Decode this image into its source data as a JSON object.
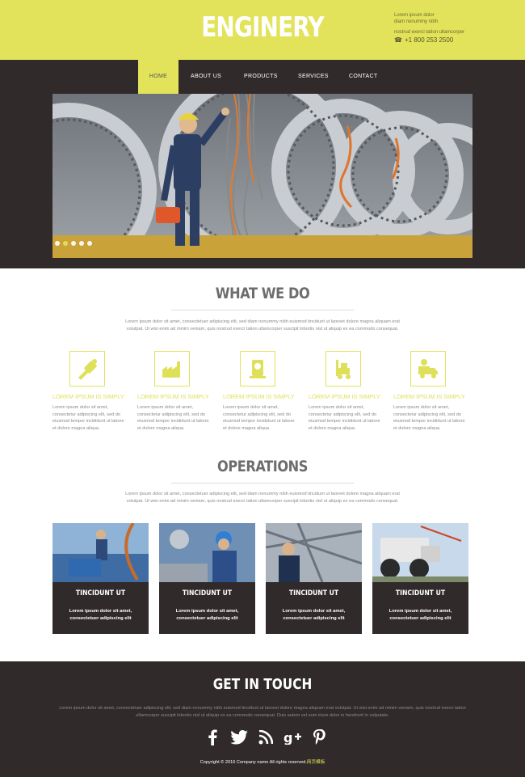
{
  "header": {
    "logo": "ENGINERY",
    "contact_line1": "Lorem ipsum dolor",
    "contact_line2": "diam nonummy nibh",
    "contact_line3": "nostrud exerci tation ullamcorper",
    "phone": "+1 800 253 2500"
  },
  "nav": {
    "items": [
      {
        "label": "HOME",
        "active": true
      },
      {
        "label": "ABOUT US",
        "active": false
      },
      {
        "label": "PRODUCTS",
        "active": false
      },
      {
        "label": "SERVICES",
        "active": false
      },
      {
        "label": "CONTACT",
        "active": false
      }
    ]
  },
  "slider": {
    "dots": 5,
    "active_dot": 2
  },
  "what_we_do": {
    "title": "WHAT WE DO",
    "intro": "Lorem ipsum dolor sit amet, consectetuer adipiscing elit, sed diam nonummy nibh euismod tincidunt ut laoreet dolore magna aliquam erat volutpat. Ut wisi enim ad minim veniam, quis nostrud exerci tation ullamcorper suscipit lobortis nisl ut aliquip ex ea commodo consequat.",
    "features": [
      {
        "icon": "tools-icon",
        "title": "LOREM IPSUM IS SIMPLY",
        "text": "Lorem ipsum dolor sit amet, consectetur adipiscing elit, sed do eiusmod tempor incididunt ut labore et dolore magna aliqua."
      },
      {
        "icon": "factory-icon",
        "title": "LOREM IPSUM IS SIMPLY",
        "text": "Lorem ipsum dolor sit amet, consectetur adipiscing elit, sed do eiusmod tempor incididunt ut labore et dolore magna aliqua."
      },
      {
        "icon": "machine-icon",
        "title": "LOREM IPSUM IS SIMPLY",
        "text": "Lorem ipsum dolor sit amet, consectetur adipiscing elit, sed do eiusmod tempor incididunt ut labore et dolore magna aliqua."
      },
      {
        "icon": "forklift-icon",
        "title": "LOREM IPSUM IS SIMPLY",
        "text": "Lorem ipsum dolor sit amet, consectetur adipiscing elit, sed do eiusmod tempor incididunt ut labore et dolore magna aliqua."
      },
      {
        "icon": "truck-icon",
        "title": "LOREM IPSUM IS SIMPLY",
        "text": "Lorem ipsum dolor sit amet, consectetur adipiscing elit, sed do eiusmod tempor incididunt ut labore et dolore magna aliqua."
      }
    ]
  },
  "operations": {
    "title": "OPERATIONS",
    "intro": "Lorem ipsum dolor sit amet, consectetuer adipiscing elit, sed diam nonummy nibh euismod tincidunt ut laoreet dolore magna aliquam erat volutpat. Ut wisi enim ad minim veniam, quis nostrud exerci tation ullamcorper suscipit lobortis nisl ut aliquip ex ea commodo consequat.",
    "cards": [
      {
        "title": "TINCIDUNT UT",
        "line1": "Lorem ipsum dolor sit amet,",
        "line2": "consectetuer adipiscing elit"
      },
      {
        "title": "TINCIDUNT UT",
        "line1": "Lorem ipsum dolor sit amet,",
        "line2": "consectetuer adipiscing elit"
      },
      {
        "title": "TINCIDUNT UT",
        "line1": "Lorem ipsum dolor sit amet,",
        "line2": "consectetuer adipiscing elit"
      },
      {
        "title": "TINCIDUNT UT",
        "line1": "Lorem ipsum dolor sit amet,",
        "line2": "consectetuer adipiscing elit"
      }
    ]
  },
  "footer": {
    "title": "GET IN TOUCH",
    "text": "Lorem ipsum dolor sit amet, consectetuer adipiscing elit, sed diam nonummy nibh euismod tincidunt ut laoreet dolore magna aliquam erat volutpat. Ut wisi enim ad minim veniam, quis nostrud exerci tation ullamcorper suscipit lobortis nisl ut aliquip ex ea commodo consequat. Duis autem vel eum iriure dolor in hendrerit in vulputate.",
    "social": [
      "facebook-icon",
      "twitter-icon",
      "rss-icon",
      "google-plus-icon",
      "pinterest-icon"
    ],
    "copyright": "Copyright © 2016 Company name All rights reserved.",
    "copyright_link": "网页模板"
  },
  "colors": {
    "accent": "#e2e35a",
    "dark": "#302a2b"
  }
}
